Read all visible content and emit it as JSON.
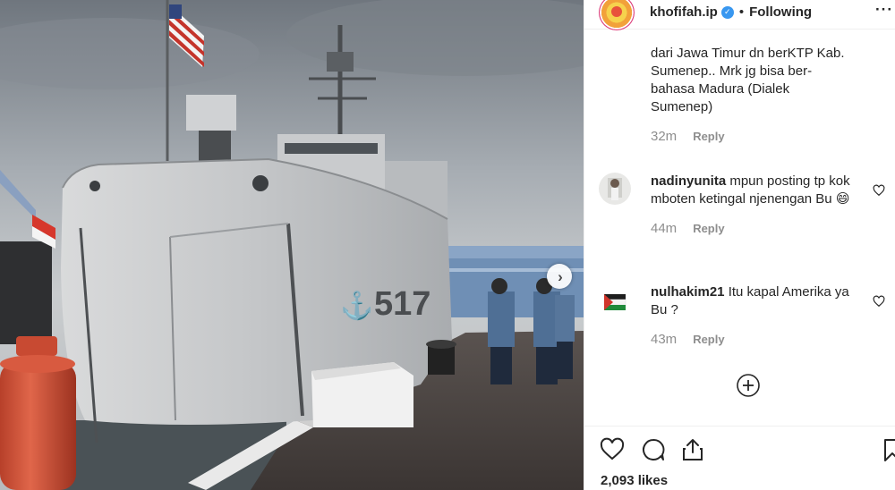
{
  "post": {
    "username": "khofifah.ip",
    "verified_mark": "✓",
    "separator": "•",
    "follow_status": "Following",
    "more_label": "···",
    "next_arrow": "›",
    "ship_hull_number": "517",
    "likes": "2,093 likes"
  },
  "comments": [
    {
      "username": "",
      "text": "dari Jawa Timur dn berKTP Kab. Sumenep.. Mrk jg bisa ber-bahasa Madura (Dialek Sumenep)",
      "time": "32m",
      "reply_label": "Reply"
    },
    {
      "username": "nadinyunita",
      "text": "mpun posting tp kok mboten ketingal njenengan Bu 😄",
      "time": "44m",
      "reply_label": "Reply"
    },
    {
      "username": "nulhakim21",
      "text": "Itu kapal Amerika ya Bu ?",
      "time": "43m",
      "reply_label": "Reply"
    }
  ],
  "icons": {
    "like": "heart-icon",
    "comment": "comment-bubble-icon",
    "share": "share-icon",
    "save": "bookmark-icon",
    "load_more": "plus-circle-icon",
    "comment_like": "heart-outline-icon"
  },
  "colors": {
    "verified": "#3897f0",
    "text": "#262626",
    "muted": "#8e8e8e",
    "border": "#efefef"
  }
}
